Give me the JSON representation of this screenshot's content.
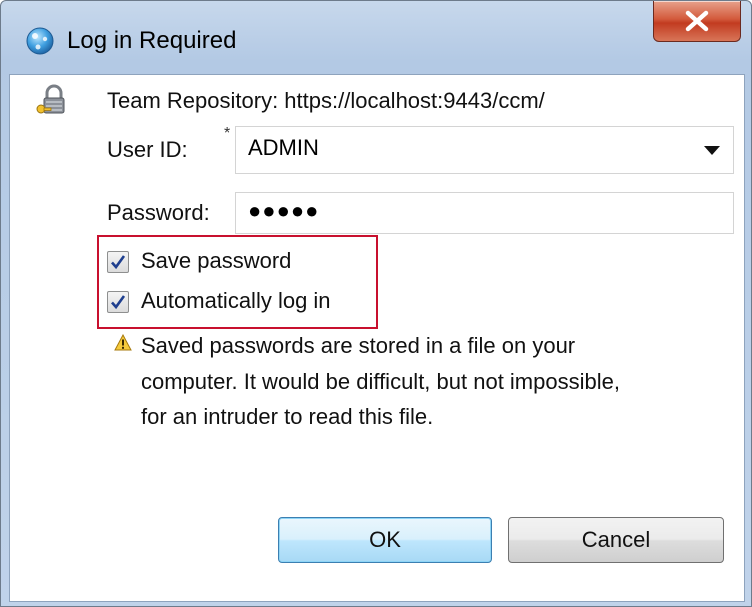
{
  "window": {
    "title": "Log in Required",
    "close_icon": "close-icon"
  },
  "repository": {
    "label": "Team Repository: https://localhost:9443/ccm/"
  },
  "user_id": {
    "label": "User ID:",
    "required_marker": "*",
    "value": "ADMIN"
  },
  "password": {
    "label": "Password:",
    "masked_value": "●●●●●"
  },
  "options": {
    "save_password": {
      "label": "Save password",
      "checked": true
    },
    "auto_login": {
      "label": "Automatically log in",
      "checked": true
    }
  },
  "warning": {
    "lines": [
      "Saved passwords are stored in a file on your",
      "computer. It would be difficult, but not impossible,",
      "for an intruder to read this file."
    ]
  },
  "buttons": {
    "ok": "OK",
    "cancel": "Cancel"
  },
  "colors": {
    "highlight": "#c8102e",
    "title_bar": "#c0d3ea",
    "close_button": "#c94a2c"
  }
}
